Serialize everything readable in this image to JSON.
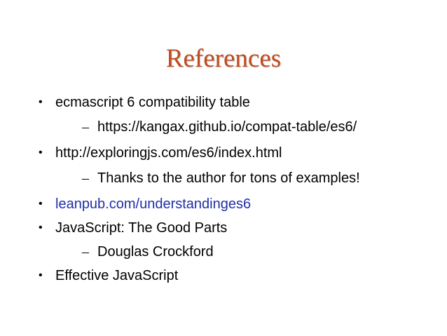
{
  "slide": {
    "title": "References",
    "bullet_glyph": "•",
    "dash_glyph": "–",
    "items": [
      {
        "text": "ecmascript 6 compatibility table",
        "is_link": false,
        "sub": "https://kangax.github.io/compat-table/es6/"
      },
      {
        "text": "http://exploringjs.com/es6/index.html",
        "is_link": false,
        "sub": "Thanks to the author for tons of examples!"
      },
      {
        "text": "leanpub.com/understandinges6",
        "is_link": true,
        "sub": null
      },
      {
        "text": "JavaScript: The Good Parts",
        "is_link": false,
        "sub": "Douglas Crockford"
      },
      {
        "text": "Effective JavaScript",
        "is_link": false,
        "sub": null
      }
    ]
  },
  "colors": {
    "title": "#c24a1c",
    "text": "#000000",
    "link": "#1f2fa8",
    "background": "#ffffff"
  }
}
